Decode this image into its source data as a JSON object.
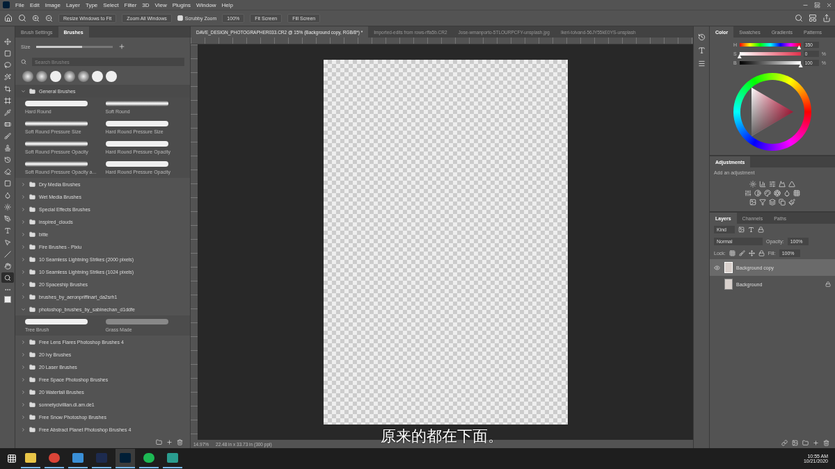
{
  "menu": [
    "File",
    "Edit",
    "Image",
    "Layer",
    "Type",
    "Select",
    "Filter",
    "3D",
    "View",
    "Plugins",
    "Window",
    "Help"
  ],
  "options_bar": {
    "buttons": [
      "Resize Windows to Fit",
      "Zoom All Windows"
    ],
    "scrubby": {
      "label": "Scrubby Zoom",
      "checked": true
    },
    "view_buttons": [
      "100%",
      "Fit Screen",
      "Fill Screen"
    ]
  },
  "tools": [
    {
      "selected": false
    },
    {
      "selected": false
    },
    {
      "selected": false
    },
    {
      "selected": false
    },
    {
      "selected": false
    },
    {
      "selected": false
    },
    {
      "selected": false
    },
    {
      "selected": false
    },
    {
      "selected": false
    },
    {
      "selected": false
    },
    {
      "selected": false
    },
    {
      "selected": false
    },
    {
      "selected": false
    },
    {
      "selected": false
    },
    {
      "selected": false
    },
    {
      "selected": false
    },
    {
      "selected": false
    },
    {
      "selected": false
    },
    {
      "selected": false
    },
    {
      "selected": false
    },
    {
      "selected": true
    },
    {
      "selected": false
    }
  ],
  "brushes_panel": {
    "tabs": [
      {
        "label": "Brush Settings",
        "selected": false
      },
      {
        "label": "Brushes",
        "selected": true
      }
    ],
    "size": {
      "label": "Size",
      "level": 0.6
    },
    "search_placeholder": "Search Brushes",
    "groups": [
      {
        "name": "General Brushes",
        "expanded": true,
        "brushes": [
          {
            "name": "Hard Round",
            "kind": "hard"
          },
          {
            "name": "Soft Round",
            "kind": "soft"
          },
          {
            "name": "Soft Round Pressure Size",
            "kind": "soft"
          },
          {
            "name": "Hard Round Pressure Size",
            "kind": "hard"
          },
          {
            "name": "Soft Round Pressure Opacity",
            "kind": "soft"
          },
          {
            "name": "Hard Round Pressure Opacity",
            "kind": "hard"
          },
          {
            "name": "Soft Round Pressure Opacity a...",
            "kind": "soft"
          },
          {
            "name": "Hard Round Pressure Opacity",
            "kind": "hard"
          }
        ]
      },
      {
        "name": "Dry Media Brushes",
        "expanded": false
      },
      {
        "name": "Wet Media Brushes",
        "expanded": false
      },
      {
        "name": "Special Effects Brushes",
        "expanded": false
      },
      {
        "name": "inspired_clouds",
        "expanded": false
      },
      {
        "name": "bitte",
        "expanded": false
      },
      {
        "name": "Fire Brushes - Pixiu",
        "expanded": false
      },
      {
        "name": "10 Seamless Lightning Strikes (2000 pixels)",
        "expanded": false
      },
      {
        "name": "10 Seamless Lightning Strikes (1024 pixels)",
        "expanded": false
      },
      {
        "name": "20 Spaceship Brushes",
        "expanded": false
      },
      {
        "name": "brushes_by_aeronpriffinart_da2srh1",
        "expanded": false
      },
      {
        "name": "photoshop_brushes_by_sabinechan_d1ddfe",
        "expanded": true,
        "brushes": [
          {
            "name": "Tree Brush",
            "kind": "hard"
          },
          {
            "name": "Grass Made",
            "kind": "grass"
          }
        ]
      },
      {
        "name": "Free Lens Flares Photoshop Brushes 4",
        "expanded": false
      },
      {
        "name": "20 Ivy Brushes",
        "expanded": false
      },
      {
        "name": "20 Laser Brushes",
        "expanded": false
      },
      {
        "name": "Free Space Photoshop Brushes",
        "expanded": false
      },
      {
        "name": "20 Waterfall Brushes",
        "expanded": false
      },
      {
        "name": "sonnetycivillian.di.am.de1",
        "expanded": false
      },
      {
        "name": "Free Snow Photoshop Brushes",
        "expanded": false
      },
      {
        "name": "Free Abstract Planet Photoshop Brushes 4",
        "expanded": false
      }
    ]
  },
  "doc_tabs": [
    {
      "label": "DAVE_DESIGN_PHOTOGRAPHER033.CR2 @ 15% (Background copy, RGB/8*) *",
      "selected": true
    },
    {
      "label": "Imported-edits from rows-rffa5b.CR2",
      "selected": false
    },
    {
      "label": "Jose-wmanporto-5TLOURPCFY-unsplash.jpg",
      "selected": false
    },
    {
      "label": "Ikeri-tolvand-56JY55kE0YS-unsplash",
      "selected": false
    }
  ],
  "status_bar": {
    "zoom": "14.97%",
    "size": "22.48 in x 33.73 in (300 ppi)"
  },
  "subtitle": "原来的都在下面。",
  "color_panel": {
    "tabs": [
      {
        "label": "Color",
        "selected": true
      },
      {
        "label": "Swatches",
        "selected": false
      },
      {
        "label": "Gradients",
        "selected": false
      },
      {
        "label": "Patterns",
        "selected": false
      }
    ],
    "sliders": [
      {
        "label": "H",
        "level": 0.97,
        "value": "350"
      },
      {
        "label": "S",
        "level": 0,
        "value": "0",
        "unit": "%"
      },
      {
        "label": "B",
        "level": 1,
        "value": "100",
        "unit": "%"
      }
    ]
  },
  "adjustments": {
    "title": "Adjustments",
    "hint": "Add an adjustment"
  },
  "layers_panel": {
    "tabs": [
      {
        "label": "Layers",
        "selected": true
      },
      {
        "label": "Channels",
        "selected": false
      },
      {
        "label": "Paths",
        "selected": false
      }
    ],
    "filter": "Kind",
    "blend_mode": "Normal",
    "opacity_label": "Opacity:",
    "opacity": "100%",
    "lock_label": "Lock:",
    "fill_label": "Fill:",
    "fill": "100%",
    "layers": [
      {
        "name": "Background copy",
        "selected": true,
        "visible": true,
        "locked": false
      },
      {
        "name": "Background",
        "selected": false,
        "visible": false,
        "locked": true
      }
    ]
  },
  "taskbar": {
    "apps": [
      {
        "selected": false
      },
      {
        "selected": false
      },
      {
        "selected": false
      },
      {
        "selected": false
      },
      {
        "selected": true
      },
      {
        "selected": false
      },
      {
        "selected": false
      }
    ],
    "time": "10:55 AM",
    "date": "10/21/2020"
  }
}
